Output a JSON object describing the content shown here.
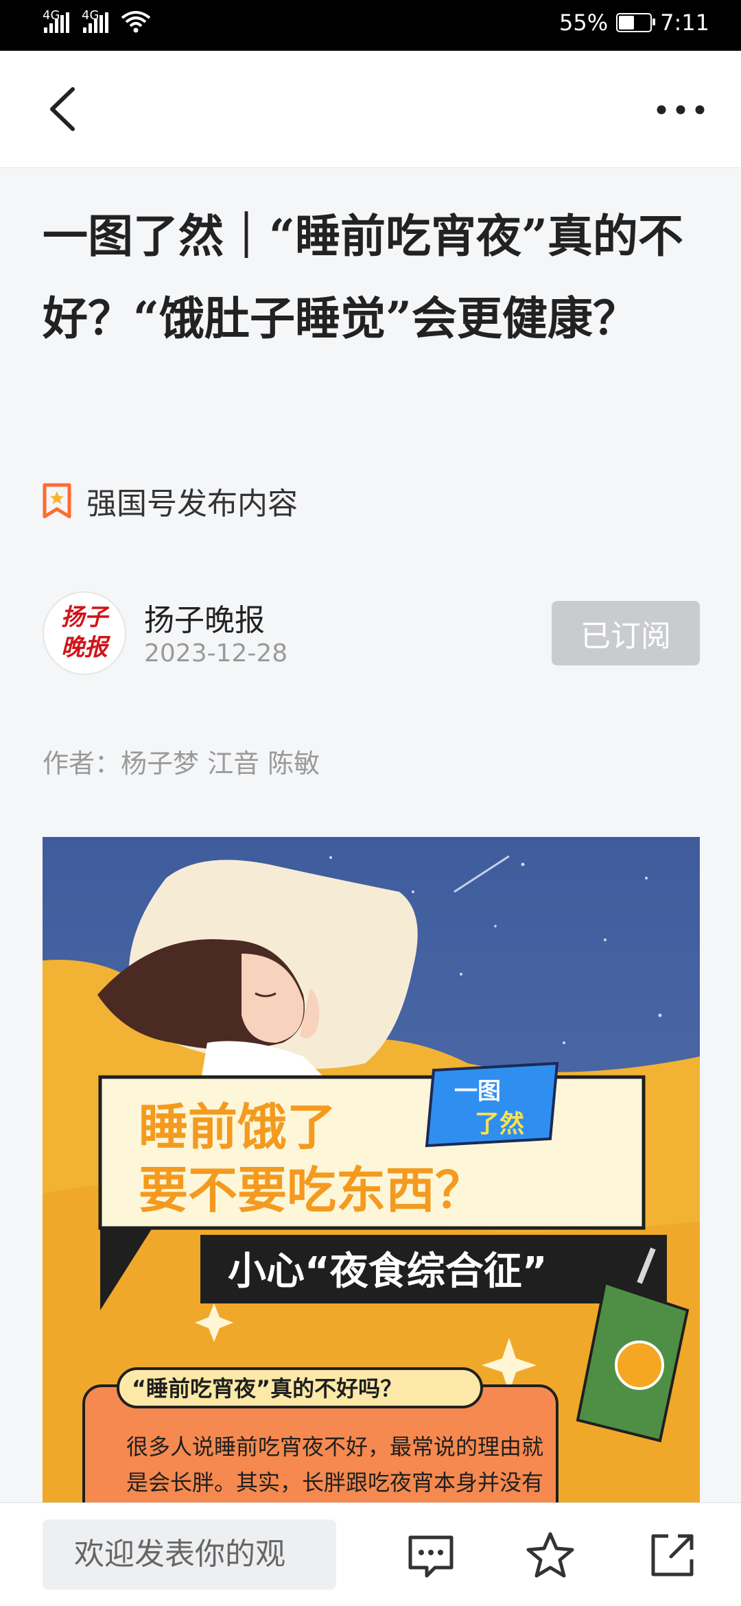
{
  "status_bar": {
    "network_1": "4G",
    "network_2": "4G",
    "battery_percent": "55%",
    "battery_level": 0.55,
    "time": "7:11"
  },
  "nav": {
    "back_icon": "chevron-left-icon",
    "more_icon": "more-horizontal-icon"
  },
  "article": {
    "title": "一图了然｜“睡前吃宵夜”真的不好？“饿肚子睡觉”会更健康？",
    "publish_tag": "强国号发布内容",
    "source_name": "扬子晚报",
    "source_logo_text": "扬子晚报",
    "date": "2023-12-28",
    "subscribe_label": "已订阅",
    "byline": "作者：杨子梦 江音 陈敏"
  },
  "illustration": {
    "headline_1": "睡前饿了",
    "headline_2": "要不要吃东西？",
    "badge_1": "一图",
    "badge_2": "了然",
    "subtitle": "小心“夜食综合征”",
    "question": "“睡前吃宵夜”真的不好吗？",
    "body_line_1": "很多人说睡前吃宵夜不好，最常说的理由就",
    "body_line_2": "是会长胖。其实，长胖跟吃夜宵本身并没有"
  },
  "bottom_bar": {
    "comment_placeholder": "欢迎发表你的观",
    "comment_icon": "comment-icon",
    "favorite_icon": "star-icon",
    "share_icon": "share-icon"
  },
  "colors": {
    "accent_orange": "#ff6b2d",
    "subscribe_bg": "#c9cbce",
    "night_sky": "#4d6aa6",
    "illustration_yellow": "#f2b233"
  }
}
